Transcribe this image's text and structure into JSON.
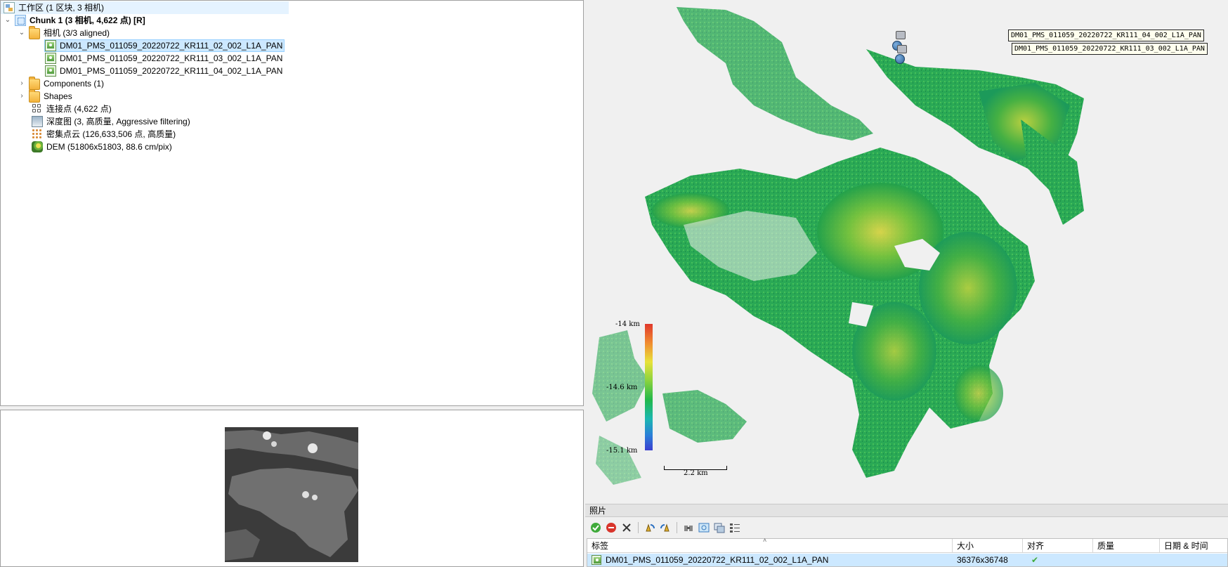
{
  "workspace": {
    "root_label": "工作区 (1 区块, 3 相机)",
    "chunk_label": "Chunk 1 (3 相机, 4,622 点) [R]",
    "cameras_folder_label": "相机 (3/3 aligned)",
    "cameras": [
      {
        "label": "DM01_PMS_011059_20220722_KR111_02_002_L1A_PAN",
        "selected": true
      },
      {
        "label": "DM01_PMS_011059_20220722_KR111_03_002_L1A_PAN",
        "selected": false
      },
      {
        "label": "DM01_PMS_011059_20220722_KR111_04_002_L1A_PAN",
        "selected": false
      }
    ],
    "components_label": "Components (1)",
    "shapes_label": "Shapes",
    "tie_points_label": "连接点 (4,622 点)",
    "depth_maps_label": "深度图 (3, 高质量, Aggressive filtering)",
    "dense_cloud_label": "密集点云 (126,633,506 点, 高质量)",
    "dem_label": "DEM (51806x51803, 88.6 cm/pix)"
  },
  "model_view": {
    "camera_labels": [
      "DM01_PMS_011059_20220722_KR111_04_002_L1A_PAN",
      "DM01_PMS_011059_20220722_KR111_03_002_L1A_PAN"
    ],
    "elevation_legend": {
      "max_label": "-14 km",
      "mid_label": "-14.6 km",
      "min_label": "-15.1 km",
      "colors": [
        "#e0382b",
        "#f08b30",
        "#e8e23a",
        "#8ad33e",
        "#22b84a",
        "#1bb7b0",
        "#2a7fd8",
        "#3a3fd0"
      ]
    },
    "scale_bar_label": "2.2 km"
  },
  "photos_panel": {
    "title": "照片",
    "toolbar_icons": [
      "enable-icon",
      "disable-icon",
      "remove-icon",
      "rotate-right-icon",
      "rotate-left-icon",
      "filter-icon",
      "camera-view-icon",
      "pane-icon",
      "details-icon"
    ],
    "columns": [
      "标签",
      "大小",
      "对齐",
      "质量",
      "日期 & 时间"
    ],
    "rows": [
      {
        "label": "DM01_PMS_011059_20220722_KR111_02_002_L1A_PAN",
        "size": "36376x36748",
        "aligned": true,
        "quality": "",
        "datetime": ""
      }
    ]
  }
}
